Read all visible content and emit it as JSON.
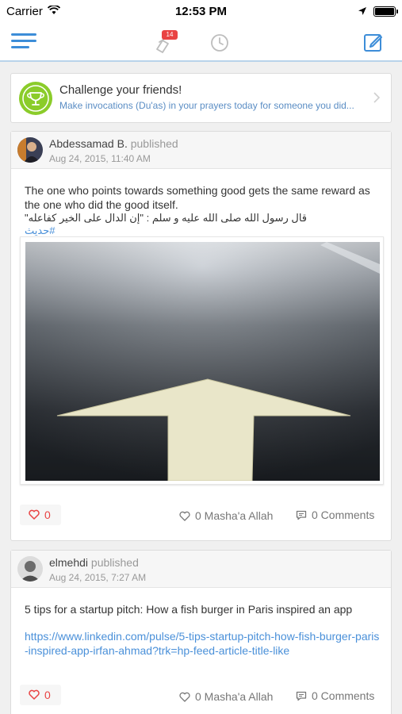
{
  "status_bar": {
    "carrier": "Carrier",
    "time": "12:53 PM",
    "battery_level": 1.0
  },
  "nav": {
    "notification_count": "14"
  },
  "challenge": {
    "title": "Challenge your friends!",
    "subtitle": "Make invocations (Du'as) in your prayers today for someone you did..."
  },
  "posts": [
    {
      "author": "Abdessamad B.",
      "verb": "published",
      "date": "Aug 24, 2015, 11:40 AM",
      "text": "The one who points towards something good gets the same reward as the one who did the good itself.",
      "arabic": "قال رسول الله صلى الله عليه و سلم : \"إن الدال على الخير كفاعله\"",
      "hashtag": "#حديث",
      "likes": "0",
      "mashaallah": "0 Masha'a Allah",
      "comments": "0 Comments"
    },
    {
      "author": "elmehdi",
      "verb": "published",
      "date": "Aug 24, 2015, 7:27 AM",
      "text": "5 tips for a startup pitch: How a fish burger in Paris inspired an app",
      "link": "https://www.linkedin.com/pulse/5-tips-startup-pitch-how-fish-burger-paris-inspired-app-irfan-ahmad?trk=hp-feed-article-title-like",
      "likes": "0",
      "mashaallah": "0 Masha'a Allah",
      "comments": "0 Comments"
    }
  ],
  "colors": {
    "accent": "#3d8dd8",
    "like": "#e94343",
    "trophy": "#8bcc2a",
    "link": "#4a90d9"
  },
  "icons": [
    "menu-icon",
    "notifications-icon",
    "clock-icon",
    "compose-icon",
    "trophy-icon",
    "chevron-right-icon",
    "heart-icon",
    "comment-icon"
  ]
}
